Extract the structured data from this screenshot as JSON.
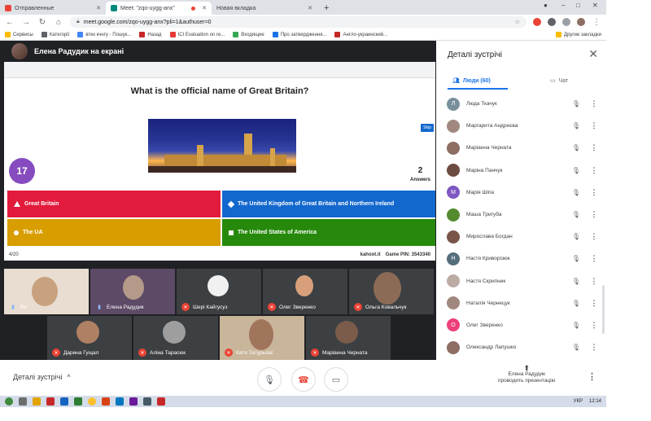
{
  "browser": {
    "tabs": [
      {
        "label": "Отправленные",
        "active": false,
        "icon_color": "#ea4335"
      },
      {
        "label": "Meet: \"zqo-uygg-anx\"",
        "active": true,
        "icon_color": "#00897b"
      },
      {
        "label": "Новая вкладка",
        "active": false,
        "icon_color": "#9aa0a6"
      }
    ],
    "new_tab_label": "+",
    "url": "meet.google.com/zqo-uygg-anx?pli=1&authuser=0",
    "bookmarks": [
      {
        "label": "Сервисы",
        "color": "#fbbc04"
      },
      {
        "label": "Категорії",
        "color": "#5f6368"
      },
      {
        "label": "втек кчнгу - Пошук...",
        "color": "#4285f4"
      },
      {
        "label": "Назад",
        "color": "#c62828"
      },
      {
        "label": "ICI Evaluation on re...",
        "color": "#e53935"
      },
      {
        "label": "Входящие",
        "color": "#34a853"
      },
      {
        "label": "Про затвердження...",
        "color": "#1a73e8"
      },
      {
        "label": "Англо-украинский...",
        "color": "#c62828"
      },
      {
        "label": "Другие закладки",
        "color": "#fbbc04"
      }
    ]
  },
  "presenter_bar": {
    "label": "Елена Радудик на екрані"
  },
  "shared_screen": {
    "question": "What is the official name of Great Britain?",
    "timer": "17",
    "answers_count": "2",
    "answers_label": "Answers",
    "skip_label": "Skip",
    "answers": [
      {
        "text": "Great Britain",
        "color": "#e21b3c",
        "shape": "triangle"
      },
      {
        "text": "The United Kingdom of Great Britain and Northern Ireland",
        "color": "#1368ce",
        "shape": "diamond"
      },
      {
        "text": "The UA",
        "color": "#d89e00",
        "shape": "circle"
      },
      {
        "text": "The United States of America",
        "color": "#26890c",
        "shape": "square"
      }
    ],
    "progress": "4/20",
    "brand": "kahoot.it",
    "game_pin": "Game PIN: 3543340"
  },
  "participants_tiles": [
    {
      "name": "Ви",
      "muted": false
    },
    {
      "name": "Елена Радудик",
      "muted": false
    },
    {
      "name": "Шері Кайгусуз",
      "muted": true
    },
    {
      "name": "Олег Зверенко",
      "muted": true
    },
    {
      "name": "Ольга Ковальчук",
      "muted": true
    },
    {
      "name": "Дарина Гущал",
      "muted": true
    },
    {
      "name": "Аліна Тарасюк",
      "muted": true
    },
    {
      "name": "Катя Татурьєвс",
      "muted": true
    },
    {
      "name": "Маріанна Черната",
      "muted": true
    }
  ],
  "panel": {
    "title": "Деталі зустрічі",
    "tab_people": "Люди (60)",
    "tab_chat": "Чат",
    "people": [
      {
        "name": "Люда Ткачук",
        "initial": "Л",
        "color": "#78909c"
      },
      {
        "name": "Маргарита Андреєва",
        "initial": "",
        "color": "#a1887f"
      },
      {
        "name": "Маріанна Черната",
        "initial": "",
        "color": "#8d6e63"
      },
      {
        "name": "Маріна Панчук",
        "initial": "",
        "color": "#6d4c41"
      },
      {
        "name": "Марія Шіпа",
        "initial": "M",
        "color": "#7e57c2"
      },
      {
        "name": "Маша Тригуба",
        "initial": "",
        "color": "#558b2f"
      },
      {
        "name": "Мирослава Богдан",
        "initial": "",
        "color": "#795548"
      },
      {
        "name": "Настя Криворізюк",
        "initial": "Н",
        "color": "#546e7a"
      },
      {
        "name": "Настя Скрипник",
        "initial": "",
        "color": "#bcaaa4"
      },
      {
        "name": "Наталія Чернецук",
        "initial": "",
        "color": "#a1887f"
      },
      {
        "name": "Олег Зверенко",
        "initial": "O",
        "color": "#ec407a"
      },
      {
        "name": "Олександр Лапушко",
        "initial": "",
        "color": "#8d6e63"
      }
    ]
  },
  "bottom_bar": {
    "details_label": "Деталі зустрічі",
    "presenter_name": "Елена Радудик",
    "presenter_status": "проводить презентацію",
    "end_call_color": "#ea4335"
  },
  "taskbar": {
    "lang": "УКР",
    "time": "12:14"
  }
}
